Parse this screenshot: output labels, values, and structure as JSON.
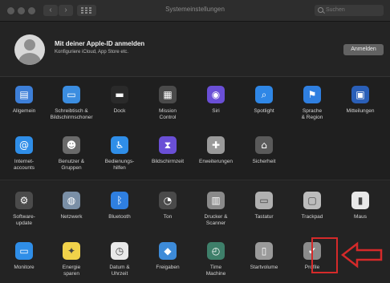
{
  "window": {
    "title": "Systemeinstellungen",
    "search_placeholder": "Suchen"
  },
  "apple_id": {
    "title": "Mit deiner Apple-ID anmelden",
    "subtitle": "Konfiguriere iCloud, App Store etc.",
    "button": "Anmelden"
  },
  "rows": {
    "r1": [
      {
        "label": "Allgemein",
        "icon": "general-icon",
        "color": "#3d7fd8"
      },
      {
        "label": "Schreibtisch &\nBildschirmschoner",
        "icon": "desktop-icon",
        "color": "#3b8de0"
      },
      {
        "label": "Dock",
        "icon": "dock-icon",
        "color": "#2a2a2a"
      },
      {
        "label": "Mission\nControl",
        "icon": "mission-control-icon",
        "color": "#4a4a4a"
      },
      {
        "label": "Siri",
        "icon": "siri-icon",
        "color": "#6a4fd6"
      },
      {
        "label": "Spotlight",
        "icon": "spotlight-icon",
        "color": "#2f87e6"
      },
      {
        "label": "Sprache\n& Region",
        "icon": "language-icon",
        "color": "#2f7fe0"
      },
      {
        "label": "Mitteilungen",
        "icon": "notifications-icon",
        "color": "#2a5fb8"
      }
    ],
    "r2": [
      {
        "label": "Internet-\naccounts",
        "icon": "internet-accounts-icon",
        "color": "#2f8ee8"
      },
      {
        "label": "Benutzer &\nGruppen",
        "icon": "users-icon",
        "color": "#6a6a6a"
      },
      {
        "label": "Bedienungs-\nhilfen",
        "icon": "accessibility-icon",
        "color": "#2f8ee8"
      },
      {
        "label": "Bildschirmzeit",
        "icon": "screen-time-icon",
        "color": "#6a4fd6"
      },
      {
        "label": "Erweiterungen",
        "icon": "extensions-icon",
        "color": "#9a9a9a"
      },
      {
        "label": "Sicherheit",
        "icon": "security-icon",
        "color": "#5a5a5a"
      }
    ],
    "r3": [
      {
        "label": "Software-\nupdate",
        "icon": "software-update-icon",
        "color": "#4b4b4b"
      },
      {
        "label": "Netzwerk",
        "icon": "network-icon",
        "color": "#7a8fa6"
      },
      {
        "label": "Bluetooth",
        "icon": "bluetooth-icon",
        "color": "#2f7fe0"
      },
      {
        "label": "Ton",
        "icon": "sound-icon",
        "color": "#4a4a4a"
      },
      {
        "label": "Drucker &\nScanner",
        "icon": "printer-icon",
        "color": "#8a8a8a"
      },
      {
        "label": "Tastatur",
        "icon": "keyboard-icon",
        "color": "#b0b0b0"
      },
      {
        "label": "Trackpad",
        "icon": "trackpad-icon",
        "color": "#bcbcbc"
      },
      {
        "label": "Maus",
        "icon": "mouse-icon",
        "color": "#e8e8e8"
      }
    ],
    "r4": [
      {
        "label": "Monitore",
        "icon": "display-icon",
        "color": "#2f8ee8"
      },
      {
        "label": "Energie\nsparen",
        "icon": "energy-saver-icon",
        "color": "#f1d24a"
      },
      {
        "label": "Datum &\nUhrzeit",
        "icon": "date-time-icon",
        "color": "#e8e8e8"
      },
      {
        "label": "Freigaben",
        "icon": "sharing-icon",
        "color": "#3d8bd9"
      },
      {
        "label": "Time\nMachine",
        "icon": "time-machine-icon",
        "color": "#3e7f6a"
      },
      {
        "label": "Startvolume",
        "icon": "startup-disk-icon",
        "color": "#9a9a9a"
      },
      {
        "label": "Profile",
        "icon": "profiles-icon",
        "color": "#8c8c8c"
      }
    ]
  },
  "annotation": {
    "highlight_color": "#d52a2a",
    "highlighted_item": "Profile"
  }
}
